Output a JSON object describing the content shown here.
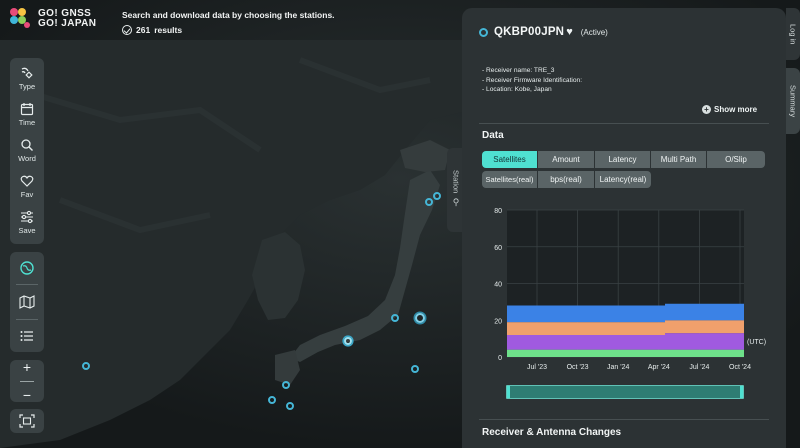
{
  "app": {
    "logo_line1": "GO! GNSS",
    "logo_line2": "GO! JAPAN",
    "headline": "Search and download data by choosing the stations.",
    "results_count": "261",
    "results_label": "results"
  },
  "toolbar": {
    "type_label": "Type",
    "time_label": "Time",
    "word_label": "Word",
    "fav_label": "Fav",
    "save_label": "Save",
    "zoom_in": "+",
    "zoom_out": "−"
  },
  "side_tab": {
    "label": "Station"
  },
  "panel": {
    "station_code": "QKBP00JPN",
    "status": "(Active)",
    "info": [
      "- Receiver name: TRE_3",
      "- Receiver Firmware Identification:",
      "- Location: Kobe, Japan"
    ],
    "show_more": "Show more",
    "data_title": "Data",
    "tabs_row1": [
      "Satellites",
      "Amount",
      "Latency",
      "Multi Path",
      "O/Slip"
    ],
    "tabs_row2": [
      "Satellites(real)",
      "bps(real)",
      "Latency(real)"
    ],
    "active_tab": "Satellites",
    "receiver_title": "Receiver & Antenna Changes"
  },
  "right_tabs": {
    "login": "Log in",
    "summary": "Summary"
  },
  "colors": {
    "accent": "#4fe0d1",
    "marker": "#45b6d6",
    "series_blue": "#3b82e6",
    "series_orange": "#f0a06c",
    "series_purple": "#a05ae0",
    "series_green": "#6ee08a"
  },
  "chart_data": {
    "type": "area",
    "stacked": true,
    "x": [
      "Jul '23",
      "Oct '23",
      "Jan '24",
      "Apr '24",
      "Jul '24",
      "Oct '24"
    ],
    "ylim": [
      0,
      80
    ],
    "yticks": [
      0,
      20,
      40,
      60,
      80
    ],
    "unit_label": "(UTC)",
    "series": [
      {
        "values": [
          4,
          4,
          4,
          4,
          4,
          4
        ]
      },
      {
        "values": [
          8,
          8,
          8,
          8,
          9,
          9
        ]
      },
      {
        "values": [
          7,
          7,
          7,
          7,
          7,
          7
        ]
      },
      {
        "values": [
          9,
          9,
          9,
          9,
          9,
          9
        ]
      }
    ],
    "grid": true
  }
}
